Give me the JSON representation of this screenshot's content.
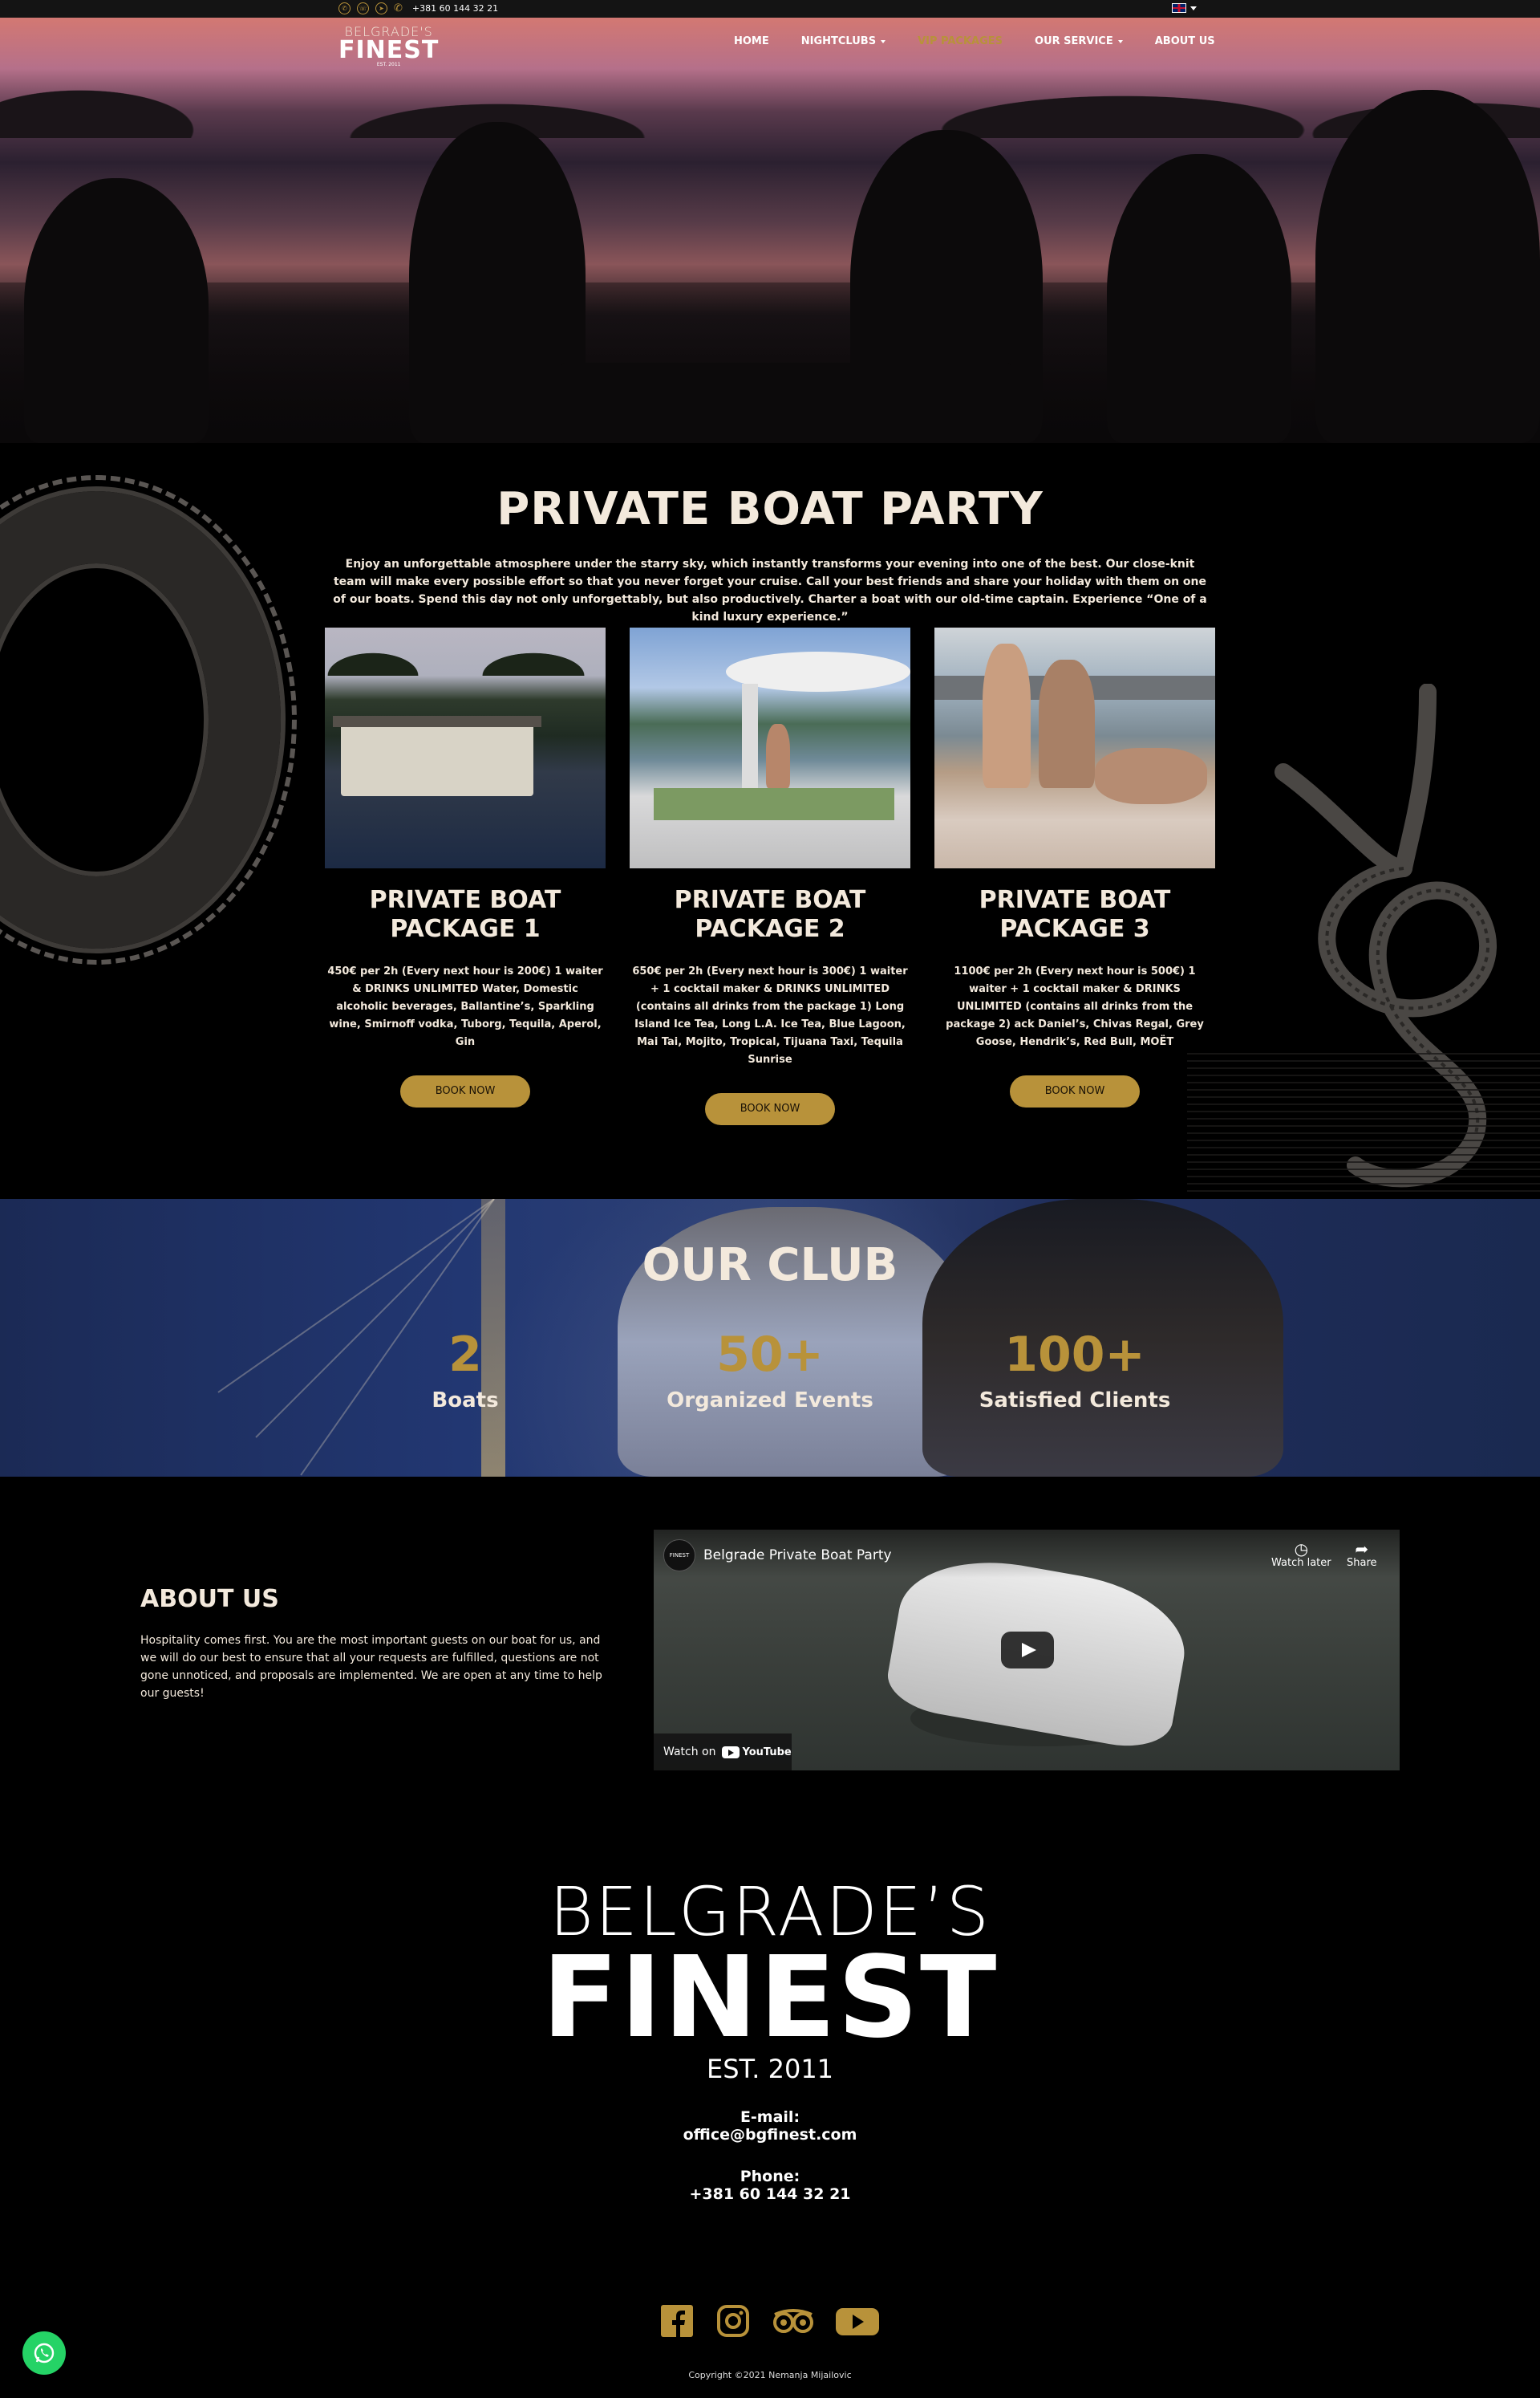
{
  "topbar": {
    "phone": "+381 60 144 32 21",
    "icons": [
      "whatsapp-icon",
      "viber-icon",
      "telegram-icon",
      "phone-icon"
    ],
    "language": "en-flag"
  },
  "nav": {
    "logo": {
      "line1": "BELGRADE'S",
      "line2": "FINEST",
      "line3": "EST. 2011"
    },
    "items": [
      {
        "label": "HOME",
        "dropdown": false,
        "active": false
      },
      {
        "label": "NIGHTCLUBS",
        "dropdown": true,
        "active": false
      },
      {
        "label": "VIP PACKAGES",
        "dropdown": false,
        "active": true
      },
      {
        "label": "OUR SERVICE",
        "dropdown": true,
        "active": false
      },
      {
        "label": "ABOUT US",
        "dropdown": false,
        "active": false
      }
    ]
  },
  "party": {
    "title": "PRIVATE BOAT PARTY",
    "intro": "Enjoy an unforgettable atmosphere under the starry sky, which instantly transforms your evening into one of the best. Our close-knit team will make every possible effort so that you never forget your cruise. Call your best friends and share your holiday with them on one of our boats. Spend this day not only unforgettably, but also productively. Charter a boat with our old-time captain. Experience “One of a kind luxury experience.”",
    "packages": [
      {
        "title": "PRIVATE BOAT PACKAGE 1",
        "description": "450€ per 2h (Every next hour is 200€) 1 waiter & DRINKS UNLIMITED Water, Domestic alcoholic beverages, Ballantine’s, Sparkling wine, Smirnoff vodka, Tuborg, Tequila, Aperol, Gin",
        "button": "BOOK NOW"
      },
      {
        "title": "PRIVATE BOAT PACKAGE 2",
        "description": "650€ per 2h (Every next hour is 300€) 1 waiter + 1 cocktail maker & DRINKS UNLIMITED (contains all drinks from the package 1) Long Island Ice Tea, Long L.A. Ice Tea, Blue Lagoon, Mai Tai, Mojito, Tropical, Tijuana Taxi, Tequila Sunrise",
        "button": "BOOK NOW"
      },
      {
        "title": "PRIVATE BOAT PACKAGE 3",
        "description": "1100€ per 2h (Every next hour is 500€) 1 waiter + 1 cocktail maker & DRINKS UNLIMITED (contains all drinks from the package 2) ack Daniel’s, Chivas Regal, Grey Goose, Hendrik’s, Red Bull, MOËT",
        "button": "BOOK NOW"
      }
    ]
  },
  "club": {
    "title": "OUR CLUB",
    "stats": [
      {
        "number": "2",
        "label": "Boats"
      },
      {
        "number": "50+",
        "label": "Organized Events"
      },
      {
        "number": "100+",
        "label": "Satisfied Clients"
      }
    ]
  },
  "about": {
    "title": "ABOUT US",
    "text": "Hospitality comes first. You are the most important guests on our boat for us, and we will do our best to ensure that all your requests are fulfilled, questions are not gone unnoticed, and proposals are implemented. We are open at any time to help our guests!"
  },
  "video": {
    "title": "Belgrade Private Boat Party",
    "channel_badge": "FINEST",
    "watch_later": "Watch later",
    "share": "Share",
    "watch_on": "Watch on",
    "youtube": "YouTube"
  },
  "footer": {
    "logo": {
      "line1": "BELGRADE’S",
      "line2": "FINEST",
      "line3": "EST. 2011"
    },
    "email_label": "E-mail:",
    "email": "office@bgfinest.com",
    "phone_label": "Phone:",
    "phone": "+381 60 144 32 21",
    "socials": [
      "facebook-icon",
      "instagram-icon",
      "tripadvisor-icon",
      "youtube-icon"
    ],
    "copyright": "Copyright ©2021 Nemanja Mijailovic"
  },
  "colors": {
    "gold": "#b8923a",
    "cream": "#f3e9dc",
    "background": "#000000",
    "whatsapp": "#25d366"
  }
}
